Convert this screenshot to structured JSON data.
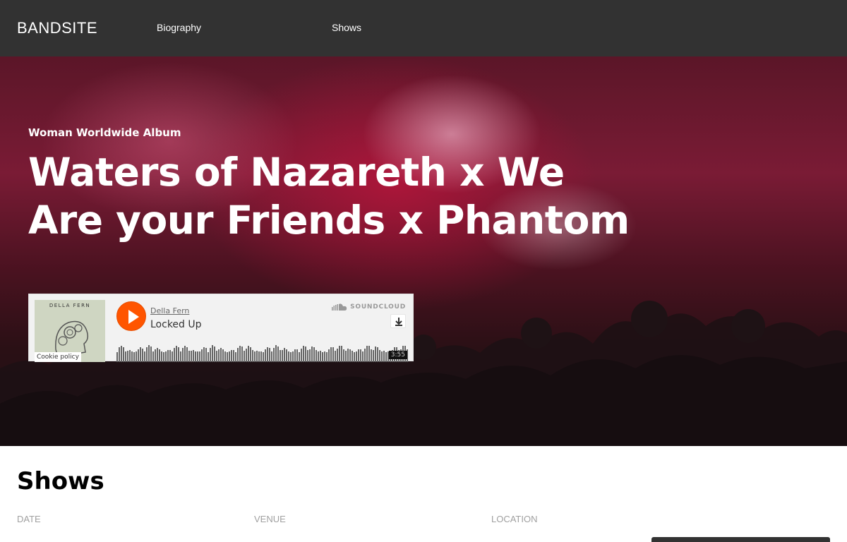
{
  "nav": {
    "logo": "BANDSITE",
    "links": [
      "Biography",
      "Shows"
    ]
  },
  "hero": {
    "eyebrow": "Woman Worldwide Album",
    "title": "Waters of Nazareth x We Are your Friends x Phantom"
  },
  "player": {
    "artwork_artist": "DELLA FERN",
    "cookie_label": "Cookie policy",
    "artist": "Della Fern",
    "track": "Locked Up",
    "brand": "SOUNDCLOUD",
    "duration": "3:55",
    "accent_color": "#ff5500",
    "icons": [
      "play-icon",
      "soundcloud-icon",
      "download-icon"
    ]
  },
  "shows": {
    "title": "Shows",
    "columns": [
      "DATE",
      "VENUE",
      "LOCATION"
    ]
  },
  "colors": {
    "nav_bg": "#323232",
    "accent": "#ff5500"
  }
}
